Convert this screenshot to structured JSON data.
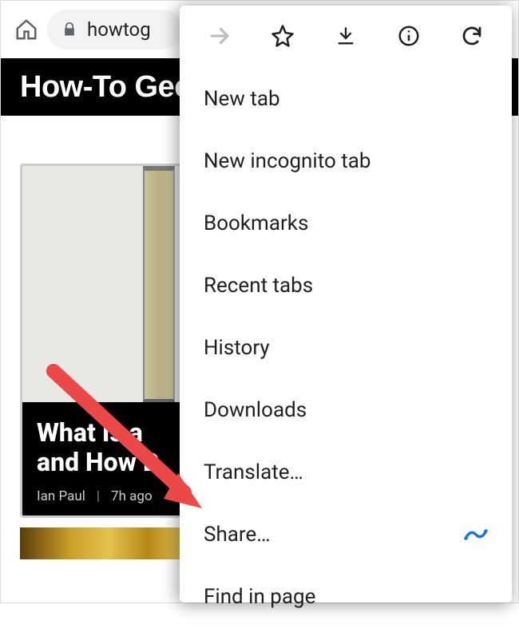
{
  "toolbar": {
    "url_fragment": "howtog"
  },
  "site": {
    "logo_text": "How-To Geek"
  },
  "article": {
    "title_line1": "What Is a",
    "title_line2": "and How D",
    "author": "Ian Paul",
    "time": "7h ago"
  },
  "menu": {
    "items": [
      {
        "label": "New tab"
      },
      {
        "label": "New incognito tab"
      },
      {
        "label": "Bookmarks"
      },
      {
        "label": "Recent tabs"
      },
      {
        "label": "History"
      },
      {
        "label": "Downloads"
      },
      {
        "label": "Translate…"
      },
      {
        "label": "Share…"
      },
      {
        "label": "Find in page"
      }
    ]
  },
  "icons": {
    "forward": "forward-icon",
    "star": "star-icon",
    "download": "download-icon",
    "info": "info-icon",
    "refresh": "refresh-icon",
    "home": "home-icon",
    "lock": "lock-icon"
  },
  "colors": {
    "menu_accent": "#1a73e8",
    "annotation": "#ed4848"
  }
}
